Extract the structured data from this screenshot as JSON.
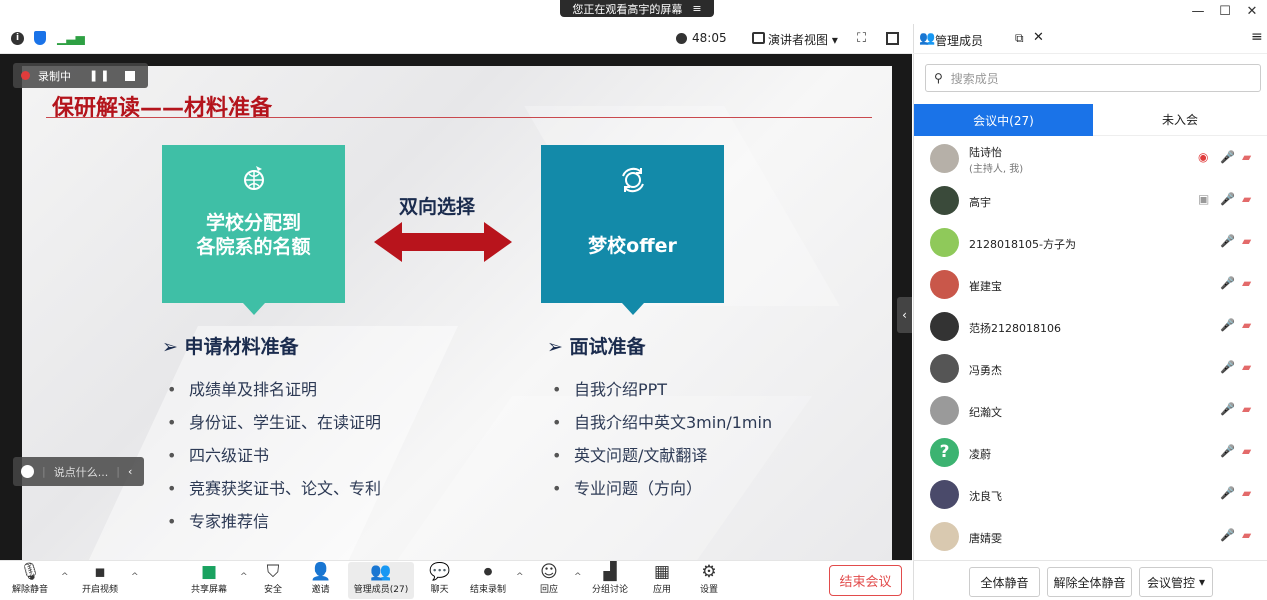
{
  "title_bar": {
    "share_banner": "您正在观看高宇的屏幕",
    "banner_icon": "≡"
  },
  "window_controls": {
    "minimize": "—",
    "maximize": "☐",
    "close": "✕"
  },
  "topbar": {
    "timer": "48:05",
    "view_label": "演讲者视图",
    "view_caret": "▾"
  },
  "recording": {
    "label": "录制中"
  },
  "chat": {
    "placeholder": "说点什么..."
  },
  "slide": {
    "title": "保研解读——材料准备",
    "left_box": {
      "line1": "学校分配到",
      "line2": "各院系的名额"
    },
    "right_box": {
      "text": "梦校offer"
    },
    "arrow_label": "双向选择",
    "left_section": {
      "heading": "申请材料准备",
      "items": [
        "成绩单及排名证明",
        "身份证、学生证、在读证明",
        "四六级证书",
        "竞赛获奖证书、论文、专利",
        "专家推荐信"
      ]
    },
    "right_section": {
      "heading": "面试准备",
      "items": [
        "自我介绍PPT",
        "自我介绍中英文3min/1min",
        "英文问题/文献翻译",
        "专业问题（方向）"
      ]
    },
    "colors": {
      "title": "#b4141c",
      "teal_left": "#3fbfa6",
      "teal_right": "#138aa9",
      "arrow": "#b8141c"
    }
  },
  "toolbar": {
    "unmute": "解除静音",
    "video": "开启视频",
    "share": "共享屏幕",
    "security": "安全",
    "invite": "邀请",
    "participants": "管理成员(27)",
    "chat": "聊天",
    "end_share": "结束录制",
    "reactions": "回应",
    "breakout": "分组讨论",
    "apps": "应用",
    "settings": "设置",
    "end_meeting": "结束会议"
  },
  "panel": {
    "title": "管理成员",
    "search_placeholder": "搜索成员",
    "tab_in": "会议中(27)",
    "tab_out": "未入会",
    "members": [
      {
        "name": "陆诗怡",
        "sub": "(主持人, 我)",
        "color": "#b6b0a8"
      },
      {
        "name": "高宇",
        "sub": "",
        "color": "#3a4a3a"
      },
      {
        "name": "2128018105-方子为",
        "sub": "",
        "color": "#8fc95a"
      },
      {
        "name": "崔建宝",
        "sub": "",
        "color": "#c9574a"
      },
      {
        "name": "范扬2128018106",
        "sub": "",
        "color": "#333333"
      },
      {
        "name": "冯勇杰",
        "sub": "",
        "color": "#555555"
      },
      {
        "name": "纪瀚文",
        "sub": "",
        "color": "#9a9a9a"
      },
      {
        "name": "凌蔚",
        "sub": "",
        "color": "#3cb371"
      },
      {
        "name": "沈良飞",
        "sub": "",
        "color": "#4a4a6a"
      },
      {
        "name": "唐婧雯",
        "sub": "",
        "color": "#d9c9b0"
      }
    ],
    "footer": {
      "mute_all": "全体静音",
      "unmute_all": "解除全体静音",
      "controls": "会议管控"
    }
  }
}
